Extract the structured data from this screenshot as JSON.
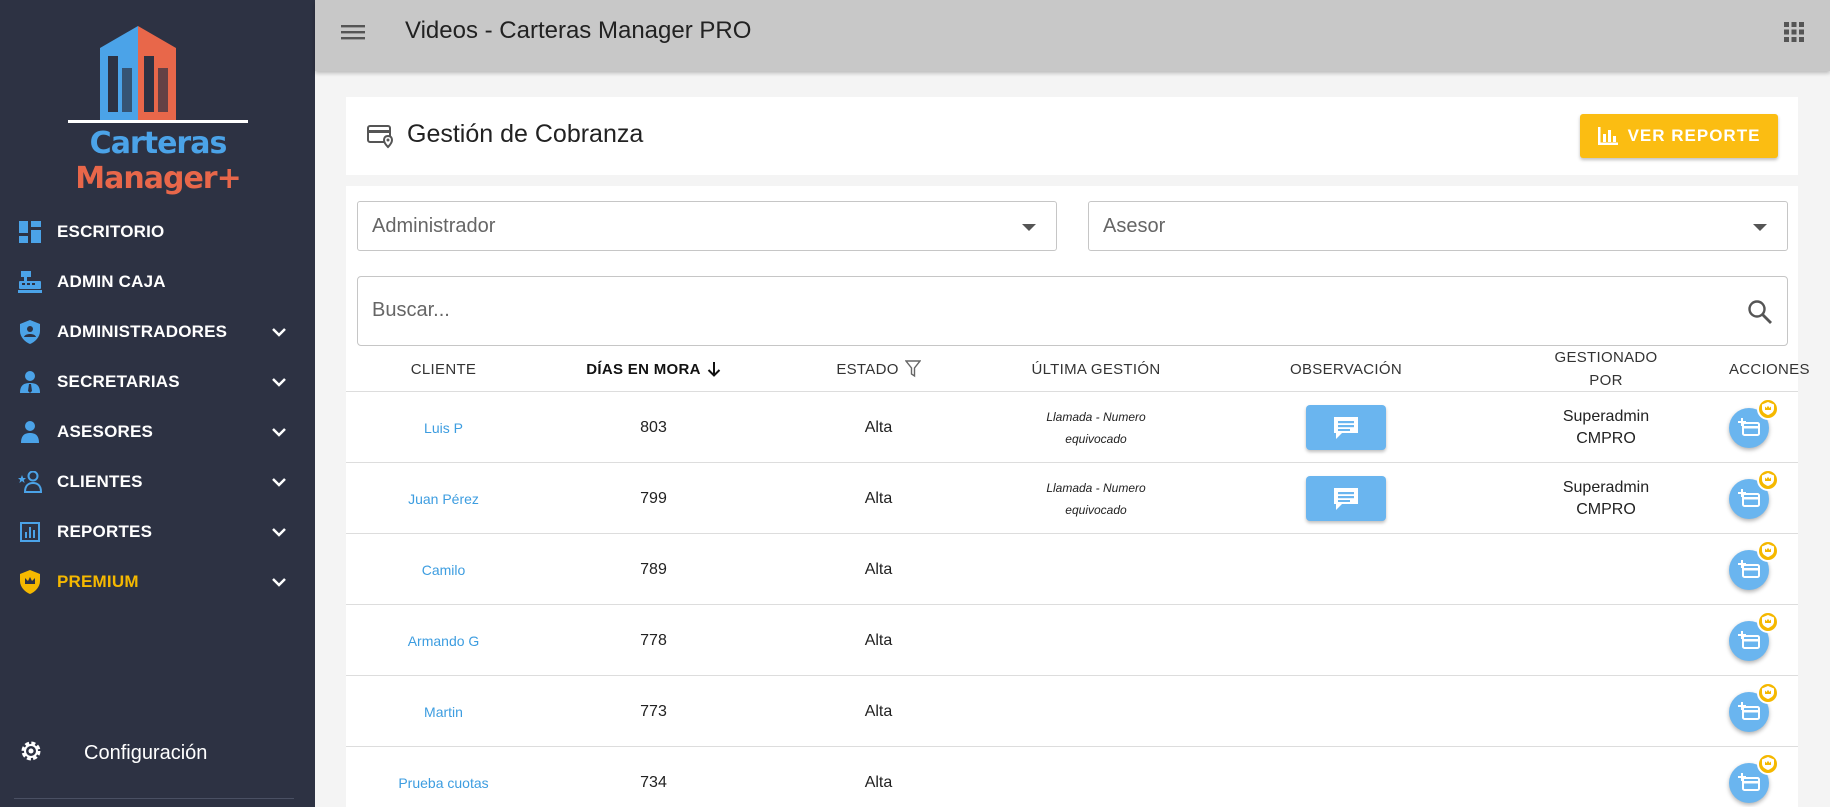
{
  "window": {
    "title": "Videos - Carteras Manager PRO"
  },
  "brand": {
    "name_part1": "Carteras ",
    "name_part2": "Manager+"
  },
  "sidebar": {
    "items": [
      {
        "label": "ESCRITORIO",
        "icon": "dashboard-icon",
        "expandable": false
      },
      {
        "label": "ADMIN CAJA",
        "icon": "cash-register-icon",
        "expandable": false
      },
      {
        "label": "ADMINISTRADORES",
        "icon": "shield-user-icon",
        "expandable": true
      },
      {
        "label": "SECRETARIAS",
        "icon": "user-tie-icon",
        "expandable": true
      },
      {
        "label": "ASESORES",
        "icon": "users-icon",
        "expandable": true
      },
      {
        "label": "CLIENTES",
        "icon": "user-star-icon",
        "expandable": true
      },
      {
        "label": "REPORTES",
        "icon": "chart-icon",
        "expandable": true
      },
      {
        "label": "PREMIUM",
        "icon": "crown-shield-icon",
        "expandable": true
      }
    ],
    "config_label": "Configuración"
  },
  "header": {
    "title": "Gestión de Cobranza",
    "report_button": "VER REPORTE"
  },
  "filters": {
    "admin_value": "Administrador",
    "asesor_value": "Asesor",
    "search_placeholder": "Buscar..."
  },
  "table": {
    "columns": {
      "cliente": "CLIENTE",
      "dias": "DÍAS EN MORA",
      "estado": "ESTADO",
      "gestion": "ÚLTIMA GESTIÓN",
      "obs": "OBSERVACIÓN",
      "por_line1": "GESTIONADO",
      "por_line2": "POR",
      "acciones": "ACCIONES"
    },
    "rows": [
      {
        "cliente": "Luis P",
        "dias": "803",
        "estado": "Alta",
        "gestion_1": "Llamada - Numero",
        "gestion_2": "equivocado",
        "has_obs": true,
        "por_1": "Superadmin",
        "por_2": "CMPRO"
      },
      {
        "cliente": "Juan Pérez",
        "dias": "799",
        "estado": "Alta",
        "gestion_1": "Llamada - Numero",
        "gestion_2": "equivocado",
        "has_obs": true,
        "por_1": "Superadmin",
        "por_2": "CMPRO"
      },
      {
        "cliente": "Camilo",
        "dias": "789",
        "estado": "Alta",
        "gestion_1": "",
        "gestion_2": "",
        "has_obs": false,
        "por_1": "",
        "por_2": ""
      },
      {
        "cliente": "Armando G",
        "dias": "778",
        "estado": "Alta",
        "gestion_1": "",
        "gestion_2": "",
        "has_obs": false,
        "por_1": "",
        "por_2": ""
      },
      {
        "cliente": "Martin",
        "dias": "773",
        "estado": "Alta",
        "gestion_1": "",
        "gestion_2": "",
        "has_obs": false,
        "por_1": "",
        "por_2": ""
      },
      {
        "cliente": "Prueba cuotas",
        "dias": "734",
        "estado": "Alta",
        "gestion_1": "",
        "gestion_2": "",
        "has_obs": false,
        "por_1": "",
        "por_2": ""
      }
    ]
  },
  "colors": {
    "sidebar_bg": "#2d3243",
    "accent_blue": "#4ba3e8",
    "button_blue": "#6ab5ef",
    "premium_yellow": "#f5b800",
    "report_button": "#fbbd12",
    "topbar_bg": "#c8c8c8"
  }
}
